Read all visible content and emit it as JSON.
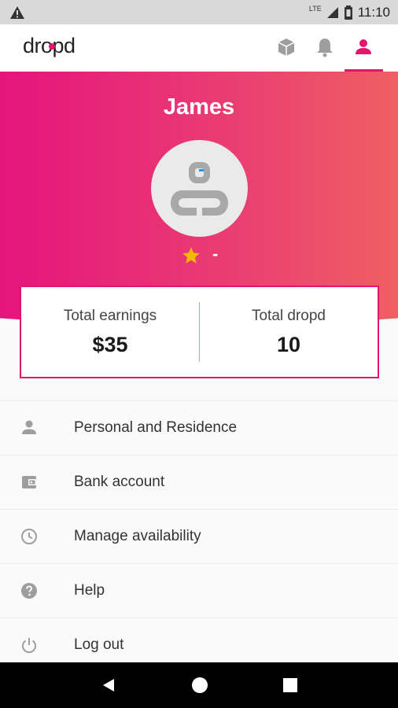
{
  "status_bar": {
    "time": "11:10",
    "network": "LTE",
    "icons": [
      "warning-icon",
      "signal-icon",
      "battery-icon"
    ]
  },
  "app_bar": {
    "logo": "dropd",
    "nav_icons": [
      "box-icon",
      "bell-icon",
      "user-icon"
    ],
    "active_tab": "user-icon"
  },
  "profile": {
    "name": "James",
    "rating": "-"
  },
  "stats": {
    "earnings_label": "Total earnings",
    "earnings_value": "$35",
    "dropd_label": "Total dropd",
    "dropd_value": "10"
  },
  "menu": {
    "items": [
      {
        "label": "Personal and Residence",
        "icon": "person-icon"
      },
      {
        "label": "Bank account",
        "icon": "wallet-icon"
      },
      {
        "label": "Manage availability",
        "icon": "clock-icon"
      },
      {
        "label": "Help",
        "icon": "help-icon"
      },
      {
        "label": "Log out",
        "icon": "power-icon"
      }
    ]
  },
  "colors": {
    "brand": "#e3156f",
    "gradient_start": "#e5147c",
    "gradient_end": "#ef5f62",
    "star": "#f5b800"
  }
}
